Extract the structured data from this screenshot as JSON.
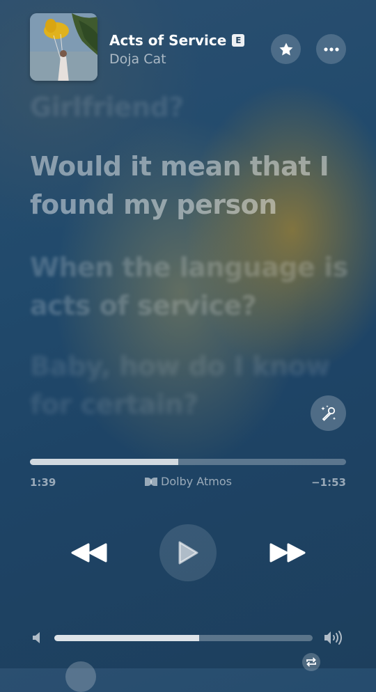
{
  "track": {
    "title": "Acts of Service",
    "explicit_badge": "E",
    "artist": "Doja Cat"
  },
  "lyrics": {
    "previous": "Girlfriend?",
    "current": "Would it mean that I found my person",
    "next_1": "When the language is acts of service?",
    "next_2": "Baby, how do I know for certain?"
  },
  "playback": {
    "elapsed": "1:39",
    "remaining": "−1:53",
    "progress_fraction": 0.47,
    "audio_format": "Dolby Atmos",
    "state": "paused"
  },
  "volume": {
    "level_fraction": 0.56
  },
  "icons": {
    "favorite": "star-icon",
    "more": "ellipsis-icon",
    "sing": "microphone-sparkle-icon",
    "rewind": "rewind-icon",
    "play": "play-icon",
    "forward": "fast-forward-icon",
    "volume_low": "speaker-low-icon",
    "volume_high": "speaker-high-icon",
    "repeat": "repeat-icon"
  },
  "colors": {
    "background_primary": "#214a6c",
    "glow": "#a08232",
    "accent": "#ffffff"
  }
}
